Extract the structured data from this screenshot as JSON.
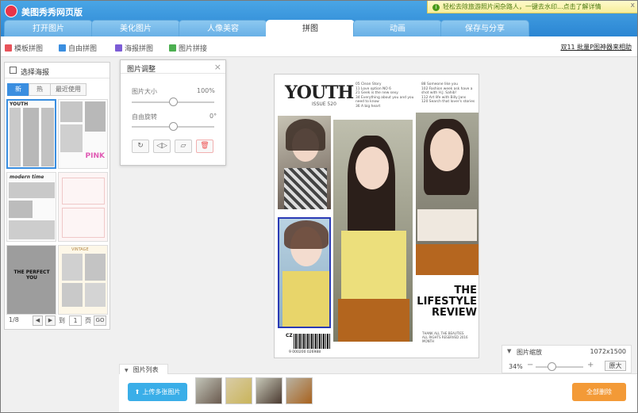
{
  "app": {
    "title": "美图秀秀网页版"
  },
  "promo": {
    "icon": "info-icon",
    "text": "轻松去除旅游照片闲杂路人，一键去水印...点击了解详情",
    "close": "x"
  },
  "tabs": [
    {
      "label": "打开图片"
    },
    {
      "label": "美化图片"
    },
    {
      "label": "人像美容"
    },
    {
      "label": "拼图",
      "active": true
    },
    {
      "label": "动画"
    },
    {
      "label": "保存与分享"
    }
  ],
  "subbar": {
    "items": [
      {
        "label": "模板拼图",
        "icon": "template-icon",
        "color": "#e8535a"
      },
      {
        "label": "自由拼图",
        "icon": "free-collage-icon",
        "color": "#3a8ee0"
      },
      {
        "label": "海报拼图",
        "icon": "poster-icon",
        "color": "#7c5cd6"
      },
      {
        "label": "图片拼接",
        "icon": "join-icon",
        "color": "#4caf50"
      }
    ],
    "batch_link": "双11 批量P图神器来相助"
  },
  "left_panel": {
    "title": "选择海报",
    "tabs": [
      "新",
      "热",
      "最近使用"
    ],
    "pager": {
      "page": "1/8",
      "to": "到",
      "value": "1",
      "unit": "页",
      "go": "GO"
    },
    "template_texts": [
      "YOUTH",
      "PINK",
      "modern time",
      "THE PERFECT YOU",
      "VINTAGE"
    ]
  },
  "adjust_panel": {
    "title": "图片调整",
    "close": "×",
    "size_label": "图片大小",
    "size_value": "100%",
    "rotate_label": "自由旋转",
    "rotate_value": "0°",
    "size_level": 0.5,
    "rotate_level": 0.5
  },
  "poster": {
    "title": "YOUTH",
    "issue": "ISSUE 520",
    "contents_col1": [
      "05  Clean Story",
      "11  Love option NO 6",
      "21  Geek is the new sexy",
      "34  Everything about you and you need to know",
      "36  A big heart"
    ],
    "contents_col2": [
      "88  Someone like you",
      "102  Fashion week ask have a shot with H.J. Sahib!",
      "112  Art life with Billy Jans",
      "120  Search that lover's stories"
    ],
    "headline": "THE LIFESTYLE REVIEW",
    "footer": "THANK ALL THE BEAUTIES ALL RIGHTS RESERVED 2016 MONTH",
    "barcode_label": "CZ",
    "barcode_number": "9 000200 026988"
  },
  "zoom_panel": {
    "title": "图片缩放",
    "size": "1072x1500",
    "percent": "34%",
    "original": "原大",
    "minus": "−",
    "plus": "+",
    "level": 0.34
  },
  "bottom": {
    "list_tab": "图片列表",
    "upload": "上传多张图片",
    "clear": "全部删除"
  }
}
